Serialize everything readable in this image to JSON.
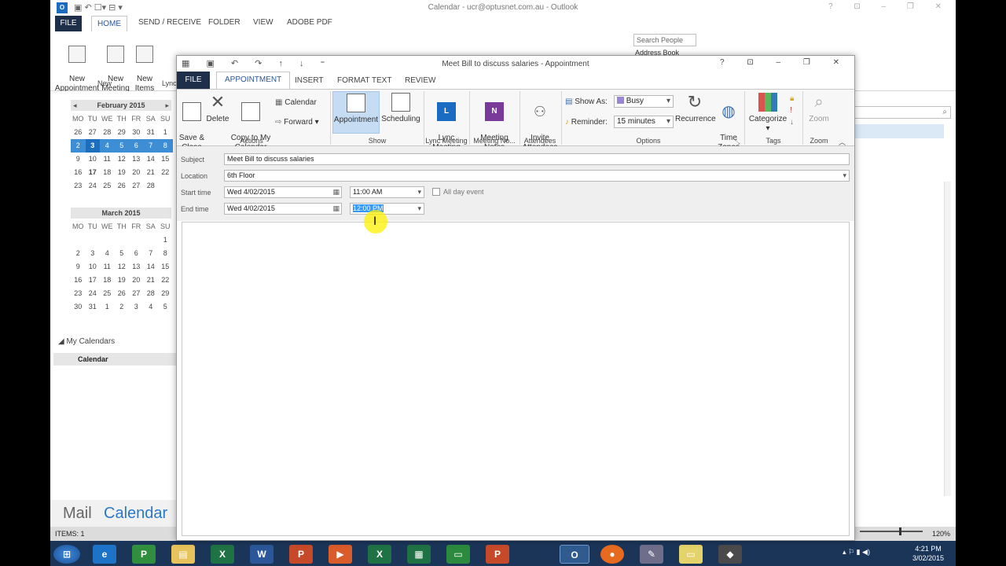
{
  "outer": {
    "window_title": "Calendar - ucr@optusnet.com.au - Outlook",
    "tabs": [
      "FILE",
      "HOME",
      "SEND / RECEIVE",
      "FOLDER",
      "VIEW",
      "ADOBE PDF"
    ],
    "ribbon": {
      "new_appointment": "New\nAppointment",
      "new_meeting": "New\nMeeting",
      "new_items": "New\nItems",
      "group_new": "New",
      "search_people_placeholder": "Search People",
      "address_book": "Address Book",
      "lync_short": "Lync"
    },
    "feb_month": "February 2015",
    "march_month": "March 2015",
    "dow": [
      "MO",
      "TU",
      "WE",
      "TH",
      "FR",
      "SA",
      "SU"
    ],
    "feb_rows": [
      [
        "26",
        "27",
        "28",
        "29",
        "30",
        "31",
        "1"
      ],
      [
        "2",
        "3",
        "4",
        "5",
        "6",
        "7",
        "8"
      ],
      [
        "9",
        "10",
        "11",
        "12",
        "13",
        "14",
        "15"
      ],
      [
        "16",
        "17",
        "18",
        "19",
        "20",
        "21",
        "22"
      ],
      [
        "23",
        "24",
        "25",
        "26",
        "27",
        "28",
        ""
      ]
    ],
    "mar_rows": [
      [
        "",
        "",
        "",
        "",
        "",
        "",
        "1"
      ],
      [
        "2",
        "3",
        "4",
        "5",
        "6",
        "7",
        "8"
      ],
      [
        "9",
        "10",
        "11",
        "12",
        "13",
        "14",
        "15"
      ],
      [
        "16",
        "17",
        "18",
        "19",
        "20",
        "21",
        "22"
      ],
      [
        "23",
        "24",
        "25",
        "26",
        "27",
        "28",
        "29"
      ],
      [
        "30",
        "31",
        "1",
        "2",
        "3",
        "4",
        "5"
      ]
    ],
    "my_calendars": "My Calendars",
    "calendar_item": "Calendar",
    "nav_mail": "Mail",
    "nav_calendar": "Calendar",
    "status_items": "ITEMS: 1",
    "zoom": "120%",
    "clock_time": "4:21 PM",
    "clock_date": "3/02/2015"
  },
  "appt": {
    "title": "Meet Bill to discuss salaries - Appointment",
    "tabs": [
      "FILE",
      "APPOINTMENT",
      "INSERT",
      "FORMAT TEXT",
      "REVIEW"
    ],
    "ribbon": {
      "save_close": "Save &\nClose",
      "delete": "Delete",
      "copy_to_cal": "Copy to My\nCalendar",
      "calendar": "Calendar",
      "forward": "Forward",
      "group_actions": "Actions",
      "appointment": "Appointment",
      "scheduling": "Scheduling",
      "group_show": "Show",
      "lync_meeting": "Lync\nMeeting",
      "group_lync": "Lync Meeting",
      "meeting_notes": "Meeting\nNotes",
      "group_notes": "Meeting No...",
      "invite": "Invite\nAttendees",
      "group_attendees": "Attendees",
      "show_as_label": "Show As:",
      "show_as_value": "Busy",
      "reminder_label": "Reminder:",
      "reminder_value": "15 minutes",
      "recurrence": "Recurrence",
      "time_zones": "Time\nZones",
      "group_options": "Options",
      "categorize": "Categorize",
      "group_tags": "Tags",
      "zoom": "Zoom",
      "group_zoom": "Zoom"
    },
    "form": {
      "subject_label": "Subject",
      "subject_value": "Meet Bill to discuss salaries",
      "location_label": "Location",
      "location_value": "6th Floor",
      "start_label": "Start time",
      "start_date": "Wed 4/02/2015",
      "start_time": "11:00 AM",
      "all_day": "All day event",
      "end_label": "End time",
      "end_date": "Wed 4/02/2015",
      "end_time": "12:00 PM"
    }
  },
  "colors": {
    "accent": "#2b579a",
    "file_tab": "#1e2f49",
    "selection": "#3399ff",
    "busy": "#9b86d6"
  }
}
